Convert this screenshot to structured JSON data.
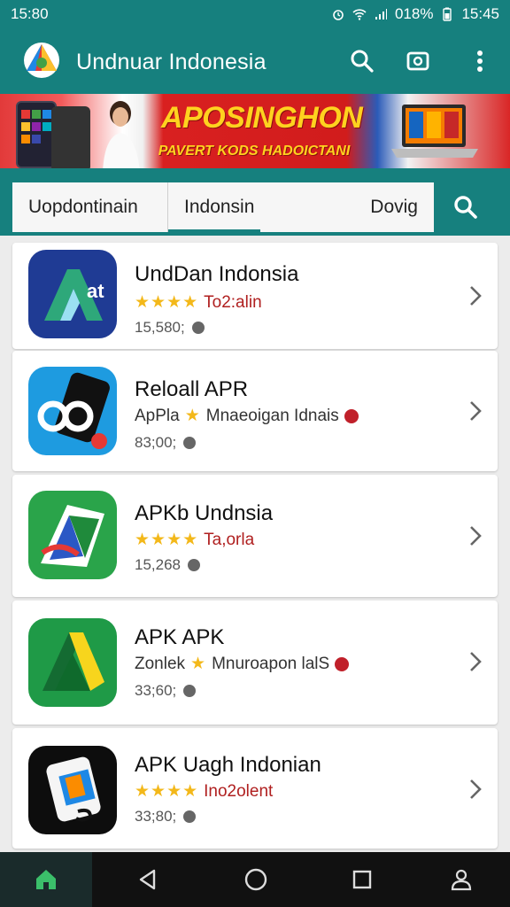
{
  "status_bar": {
    "time_left": "15:80",
    "battery": "018%",
    "time_right": "15:45",
    "icons": [
      "alarm-icon",
      "wifi-icon",
      "signal-icon",
      "battery-icon"
    ]
  },
  "app_bar": {
    "title": "Undnuar Indonesia",
    "icons": [
      "search-icon",
      "cast-icon",
      "more-vert-icon"
    ]
  },
  "banner": {
    "headline": "APOSINGHON",
    "subline": "PAVERT KODS HADOICTANI"
  },
  "tabs": {
    "items": [
      {
        "label": "Uopdontinain"
      },
      {
        "label": "Indonsin"
      },
      {
        "label": "Dovig"
      }
    ],
    "search_icon": "search-icon"
  },
  "apps": [
    {
      "name": "UndDan Indonsia",
      "stars": "★★★★",
      "rating_text": "To2:alin",
      "meta": "15,580;"
    },
    {
      "name": "Reloall APR",
      "stars": "★",
      "rating_prefix": "ApPla",
      "rating_text": "Mnaeoigan Idnais",
      "meta": "83;00;"
    },
    {
      "name": "APKb Undnsia",
      "stars": "★★★★",
      "rating_text": "Ta,orla",
      "meta": "15,268"
    },
    {
      "name": "APK APK",
      "stars": "★",
      "rating_prefix": "Zonlek",
      "rating_text": "Mnuroapon lalS",
      "meta": "33;60;"
    },
    {
      "name": "APK Uagh Indonian",
      "stars": "★★★★",
      "rating_text": "Ino2olent",
      "meta": "33;80;"
    }
  ],
  "nav_bar": {
    "icons": [
      "home-icon",
      "back-icon",
      "home-circle-icon",
      "recents-icon",
      "profile-icon"
    ]
  },
  "colors": {
    "primary": "#16807e",
    "star": "#f3b81a",
    "accent_red": "#b02020"
  }
}
